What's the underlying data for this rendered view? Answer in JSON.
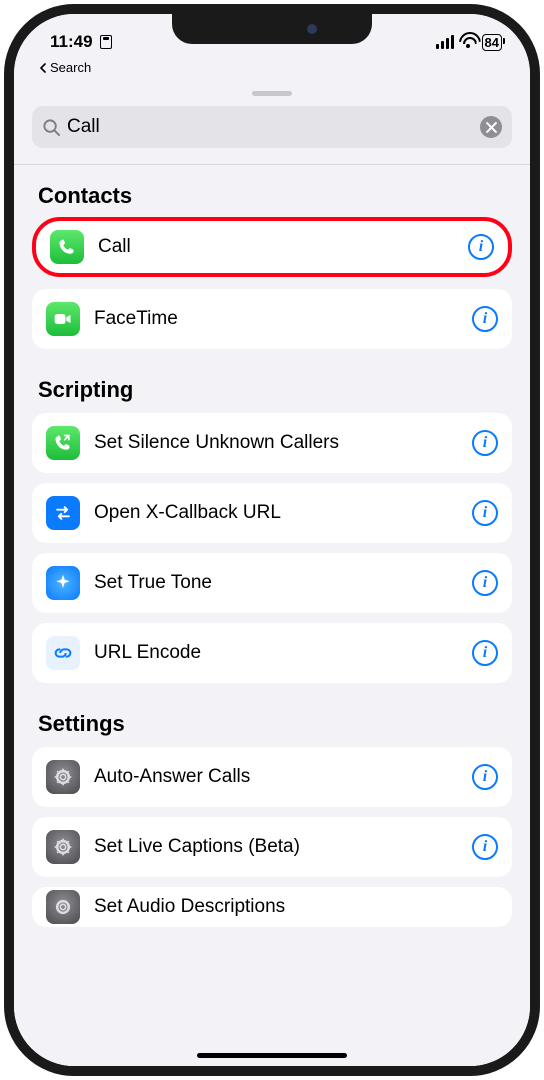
{
  "status": {
    "time": "11:49",
    "battery": "84"
  },
  "back_label": "Search",
  "search": {
    "value": "Call"
  },
  "sections": [
    {
      "title": "Contacts",
      "items": [
        {
          "label": "Call",
          "icon": "phone",
          "highlighted": true
        },
        {
          "label": "FaceTime",
          "icon": "facetime"
        }
      ]
    },
    {
      "title": "Scripting",
      "items": [
        {
          "label": "Set Silence Unknown Callers",
          "icon": "phone-incoming"
        },
        {
          "label": "Open X-Callback URL",
          "icon": "swap"
        },
        {
          "label": "Set True Tone",
          "icon": "sparkle"
        },
        {
          "label": "URL Encode",
          "icon": "link"
        }
      ]
    },
    {
      "title": "Settings",
      "items": [
        {
          "label": "Auto-Answer Calls",
          "icon": "gear"
        },
        {
          "label": "Set Live Captions (Beta)",
          "icon": "gear"
        },
        {
          "label": "Set Audio Descriptions",
          "icon": "gear"
        }
      ]
    }
  ]
}
